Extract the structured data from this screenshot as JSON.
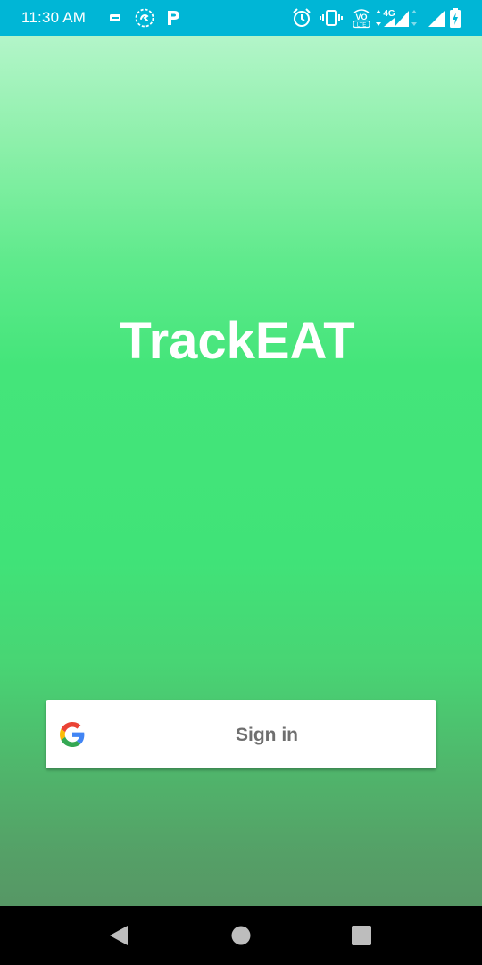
{
  "status_bar": {
    "time": "11:30 AM",
    "left_icons": [
      "airtel-icon",
      "cast-icon",
      "paytm-icon"
    ],
    "right_icons": [
      "alarm-icon",
      "vibrate-icon",
      "volte-icon",
      "4g-signal-icon",
      "signal-icon",
      "battery-charging-icon"
    ],
    "volte_text": "VO",
    "network_text": "4G",
    "color": "#00b6d6"
  },
  "app": {
    "title": "TrackEAT",
    "signin": {
      "label": "Sign in",
      "icon": "google-icon"
    }
  },
  "nav_bar": {
    "buttons": [
      "back-icon",
      "home-icon",
      "recents-icon"
    ]
  }
}
